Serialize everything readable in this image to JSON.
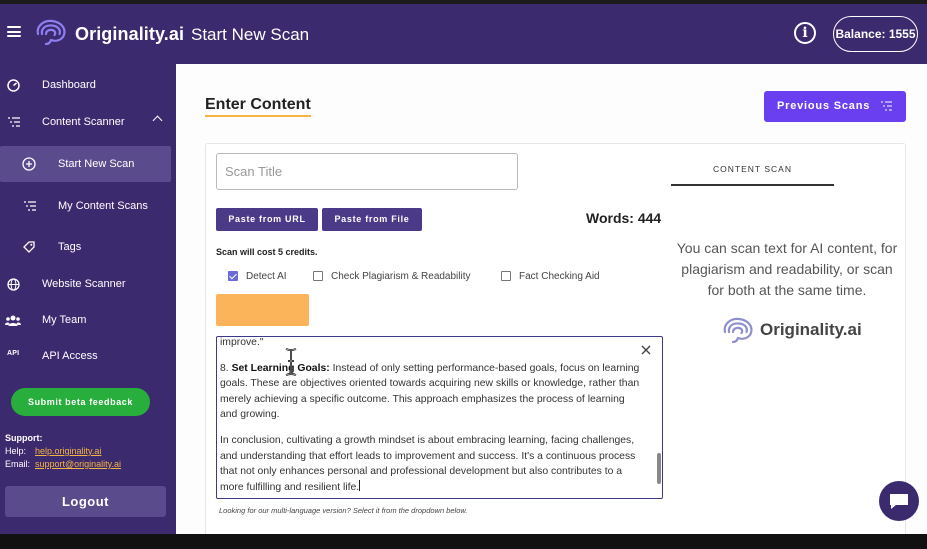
{
  "header": {
    "brand": "Originality.ai",
    "title": "Start New Scan",
    "balance": "Balance: 1555"
  },
  "sidebar": {
    "items": [
      {
        "label": "Dashboard",
        "icon": "dashboard-icon"
      },
      {
        "label": "Content Scanner",
        "icon": "list-icon"
      },
      {
        "label": "Start New Scan",
        "icon": "plus-circle-icon"
      },
      {
        "label": "My Content Scans",
        "icon": "list-icon"
      },
      {
        "label": "Tags",
        "icon": "tag-icon"
      },
      {
        "label": "Website Scanner",
        "icon": "globe-icon"
      },
      {
        "label": "My Team",
        "icon": "team-icon"
      },
      {
        "label": "API Access",
        "icon": "api-icon"
      }
    ],
    "beta_button": "Submit beta feedback",
    "support": {
      "title": "Support:",
      "help_label": "Help:",
      "help_value": "help.originality.ai",
      "email_label": "Email:",
      "email_value": "support@originality.ai"
    },
    "logout": "Logout"
  },
  "main": {
    "heading": "Enter Content",
    "previous_scans": "Previous Scans",
    "scan_title_placeholder": "Scan Title",
    "paste_url": "Paste from URL",
    "paste_file": "Paste from File",
    "words": "Words: 444",
    "cost": "Scan will cost 5 credits.",
    "options": [
      {
        "label": "Detect AI",
        "checked": true
      },
      {
        "label": "Check Plagiarism & Readability",
        "checked": false
      },
      {
        "label": "Fact Checking Aid",
        "checked": false
      }
    ],
    "content": {
      "line0": "improve.\"",
      "p1_num": "8. ",
      "p1_bold": "Set Learning Goals:",
      "p1_text": " Instead of only setting performance-based goals, focus on learning goals. These are objectives oriented towards acquiring new skills or knowledge, rather than merely achieving a specific outcome. This approach emphasizes the process of learning and growing.",
      "p2_text": "In conclusion, cultivating a growth mindset is about embracing learning, facing challenges, and understanding that effort leads to improvement and success. It's a continuous process that not only enhances personal and professional development but also contributes to a more fulfilling and resilient life."
    },
    "hint": "Looking for our multi-language version? Select it from the dropdown below.",
    "tab": "CONTENT SCAN",
    "description": "You can scan text for AI content, for plagiarism and readability, or scan for both at the same time.",
    "brand": "Originality.ai"
  },
  "colors": {
    "nav_bg": "#3b2a6e",
    "accent_purple": "#6a3ff0",
    "beta_green": "#27ae3c",
    "highlight_yellow": "#fbb45a"
  }
}
